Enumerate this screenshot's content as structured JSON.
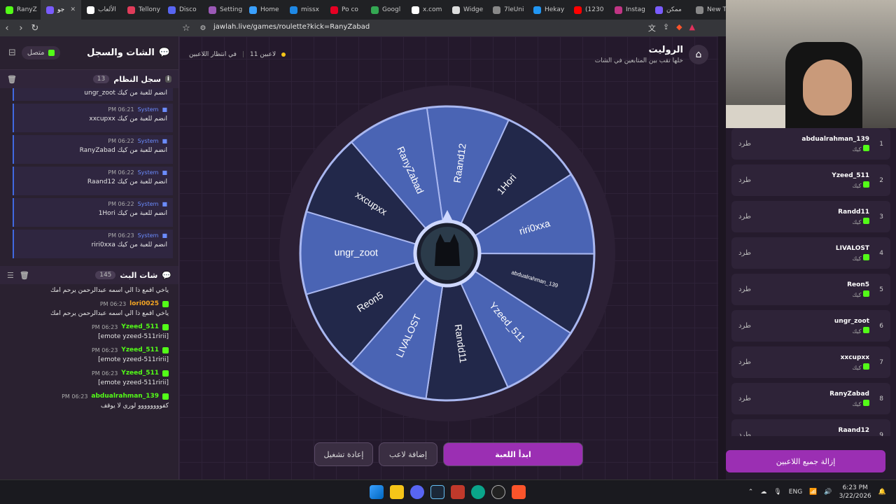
{
  "browser": {
    "tabs": [
      {
        "label": "RanyZ",
        "color": "#53fc18"
      },
      {
        "label": "جو",
        "color": "#7a5cff",
        "active": true
      },
      {
        "label": "الألعاب",
        "color": "#ffffff"
      },
      {
        "label": "Tellony",
        "color": "#e03c5a"
      },
      {
        "label": "Disco",
        "color": "#5865f2"
      },
      {
        "label": "Setting",
        "color": "#9b59b6"
      },
      {
        "label": "Home",
        "color": "#3aa0ff"
      },
      {
        "label": "missx",
        "color": "#1e88e5"
      },
      {
        "label": "Po co",
        "color": "#e60023"
      },
      {
        "label": "Googl",
        "color": "#34a853"
      },
      {
        "label": "x.com",
        "color": "#ffffff"
      },
      {
        "label": "Widge",
        "color": "#dddddd"
      },
      {
        "label": "7leUni",
        "color": "#888888"
      },
      {
        "label": "Hekay",
        "color": "#2196f3"
      },
      {
        "label": "(1230",
        "color": "#ff0000"
      },
      {
        "label": "Instag",
        "color": "#c13584"
      },
      {
        "label": "ممكن",
        "color": "#7a5cff"
      },
      {
        "label": "New T",
        "color": "#888888"
      }
    ],
    "url": "jawlah.live/games/roulette?kick=RanyZabad"
  },
  "left_panel": {
    "title": "الشات والسجل",
    "status": "متصل",
    "system_log": {
      "title": "سجل النظام",
      "count": "13",
      "items": [
        {
          "time": "",
          "sender": "",
          "msg": "ungr_zoot انضم للعبة من كيك"
        },
        {
          "time": "PM 06:21",
          "sender": "System",
          "msg": "xxcupxx انضم للعبة من كيك"
        },
        {
          "time": "PM 06:22",
          "sender": "System",
          "msg": "RanyZabad انضم للعبة من كيك"
        },
        {
          "time": "PM 06:22",
          "sender": "System",
          "msg": "Raand12 انضم للعبة من كيك"
        },
        {
          "time": "PM 06:22",
          "sender": "System",
          "msg": "1Hori انضم للعبة من كيك"
        },
        {
          "time": "PM 06:23",
          "sender": "System",
          "msg": "riri0xxa انضم للعبة من كيك"
        }
      ]
    },
    "stream_chat": {
      "title": "شات البث",
      "count": "145",
      "items": [
        {
          "time": "",
          "user": "",
          "user_color": "#ffffff",
          "msg": "ياخي اقمع ذا الي اسمه عبدالرحمن يرحم امك"
        },
        {
          "time": "PM 06:23",
          "user": "lori0025",
          "user_color": "#f5a623",
          "msg": "ياخي اقمع ذا الي اسمه عبدالرحمن يرحم امك"
        },
        {
          "time": "PM 06:23",
          "user": "Yzeed_511",
          "user_color": "#53fc18",
          "msg": "[emote yzeed-511ririi]"
        },
        {
          "time": "PM 06:23",
          "user": "Yzeed_511",
          "user_color": "#53fc18",
          "msg": "[emote yzeed-511ririi]"
        },
        {
          "time": "PM 06:23",
          "user": "Yzeed_511",
          "user_color": "#53fc18",
          "msg": "[emote yzeed-511ririi]"
        },
        {
          "time": "PM 06:23",
          "user": "abdualrahman_139",
          "user_color": "#53fc18",
          "msg": "كفوووووووو لوري لا يوقف"
        }
      ]
    }
  },
  "main": {
    "title": "الروليت",
    "subtitle": "خلها تقب بين المتابعين في الشات",
    "players_count": "11 لاعبين",
    "waiting": "في انتظار اللاعبين",
    "wheel_segments": [
      "Raand12",
      "1Hori",
      "riri0xxa",
      "abdualrahman_139",
      "Yzeed_511",
      "Randd11",
      "LIVALOST",
      "Reon5",
      "ungr_zoot",
      "xxcupxx",
      "RanyZabad"
    ],
    "colors": {
      "seg_a": "#4a64b4",
      "seg_b": "#22284a",
      "ring": "#2c2035",
      "border": "#a9b7f0"
    },
    "buttons": {
      "start": "ابدأ اللعبة",
      "add_player": "إضافة لاعب",
      "restart": "إعادة تشغيل"
    }
  },
  "right_panel": {
    "players": [
      {
        "num": "1",
        "name": "abdualrahman_139",
        "sub": "كيك",
        "kick": "طرد"
      },
      {
        "num": "2",
        "name": "Yzeed_511",
        "sub": "كيك",
        "kick": "طرد"
      },
      {
        "num": "3",
        "name": "Randd11",
        "sub": "كيك",
        "kick": "طرد"
      },
      {
        "num": "4",
        "name": "LIVALOST",
        "sub": "كيك",
        "kick": "طرد"
      },
      {
        "num": "5",
        "name": "Reon5",
        "sub": "كيك",
        "kick": "طرد"
      },
      {
        "num": "6",
        "name": "ungr_zoot",
        "sub": "كيك",
        "kick": "طرد"
      },
      {
        "num": "7",
        "name": "xxcupxx",
        "sub": "كيك",
        "kick": "طرد"
      },
      {
        "num": "8",
        "name": "RanyZabad",
        "sub": "كيك",
        "kick": "طرد"
      },
      {
        "num": "9",
        "name": "Raand12",
        "sub": "كيك",
        "kick": "طرد"
      }
    ],
    "remove_all": "إزالة جميع اللاعبين"
  },
  "taskbar": {
    "lang": "ENG",
    "time": "6:23 PM",
    "date": "3/22/2026"
  }
}
